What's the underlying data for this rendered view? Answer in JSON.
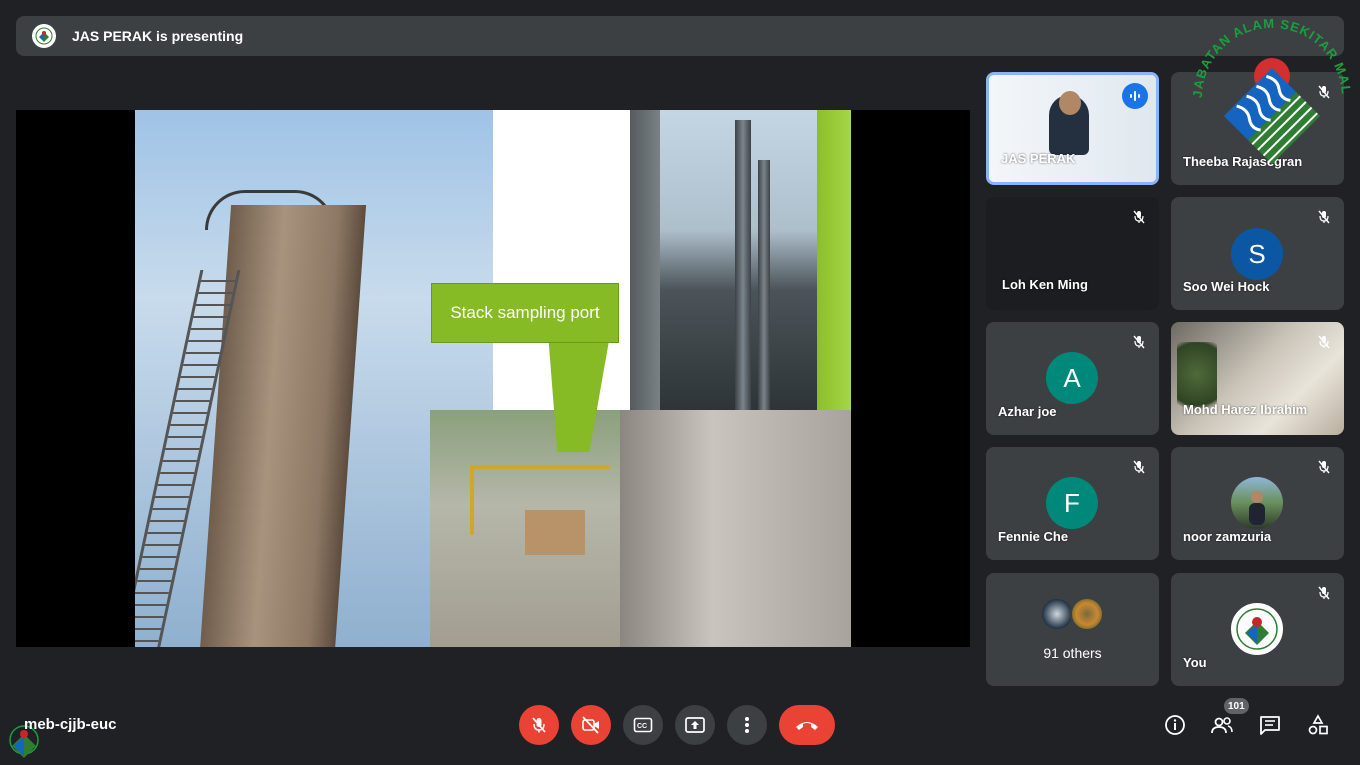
{
  "banner": {
    "text": "JAS PERAK is presenting"
  },
  "slide": {
    "callout_text": "Stack sampling port"
  },
  "participants": [
    {
      "name": "JAS PERAK",
      "speaking": true
    },
    {
      "name": "Theeba Rajasegran",
      "muted": true
    },
    {
      "name": "Loh Ken Ming",
      "muted": true
    },
    {
      "name": "Soo Wei Hock",
      "muted": true,
      "initial": "S",
      "color": "#0b57a3"
    },
    {
      "name": "Azhar joe",
      "muted": true,
      "initial": "A",
      "color": "#00897b"
    },
    {
      "name": "Mohd Harez Ibrahim",
      "muted": true
    },
    {
      "name": "Fennie Che",
      "muted": true,
      "initial": "F",
      "color": "#00897b"
    },
    {
      "name": "noor zamzuria",
      "muted": true
    },
    {
      "name": "91 others"
    },
    {
      "name": "You",
      "muted": true
    }
  ],
  "meeting": {
    "code": "meb-cjjb-euc",
    "participant_count": "101"
  },
  "logo": {
    "text": "JABATAN ALAM SEKITAR MALAYSIA"
  },
  "colors": {
    "background": "#202124",
    "tile": "#3c4043",
    "danger": "#ea4335",
    "accent": "#1a73e8"
  }
}
